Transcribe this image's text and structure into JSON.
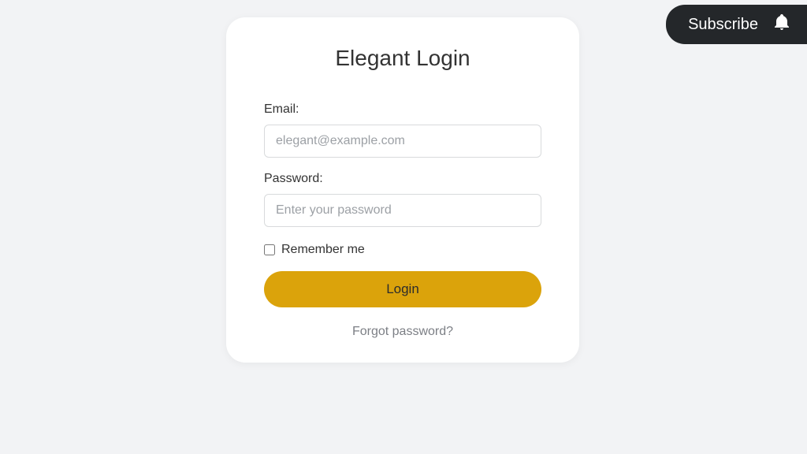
{
  "subscribe": {
    "label": "Subscribe"
  },
  "login": {
    "title": "Elegant Login",
    "email_label": "Email:",
    "email_placeholder": "elegant@example.com",
    "password_label": "Password:",
    "password_placeholder": "Enter your password",
    "remember_label": "Remember me",
    "submit_label": "Login",
    "forgot_label": "Forgot password?"
  }
}
